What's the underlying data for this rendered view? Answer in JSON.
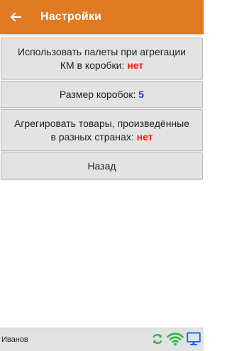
{
  "header": {
    "title": "Настройки"
  },
  "buttons": {
    "pallets_line1": "Использовать палеты при агрегации",
    "pallets_line2": "КМ в коробки: ",
    "pallets_value": "нет",
    "box_size_label": "Размер коробок: ",
    "box_size_value": "5",
    "countries_line1": "Агрегировать товары, произведённые",
    "countries_line2": "в разных странах: ",
    "countries_value": "нет",
    "back": "Назад"
  },
  "statusbar": {
    "user": "Иванов",
    "icons": [
      "sync-icon",
      "wifi-icon",
      "monitor-icon"
    ]
  },
  "colors": {
    "appbar": "#e07b24",
    "value_no": "#ff1a1a",
    "value_number": "#1f3cc9",
    "icon_green": "#2bb24c",
    "icon_blue": "#1e6fd6"
  }
}
